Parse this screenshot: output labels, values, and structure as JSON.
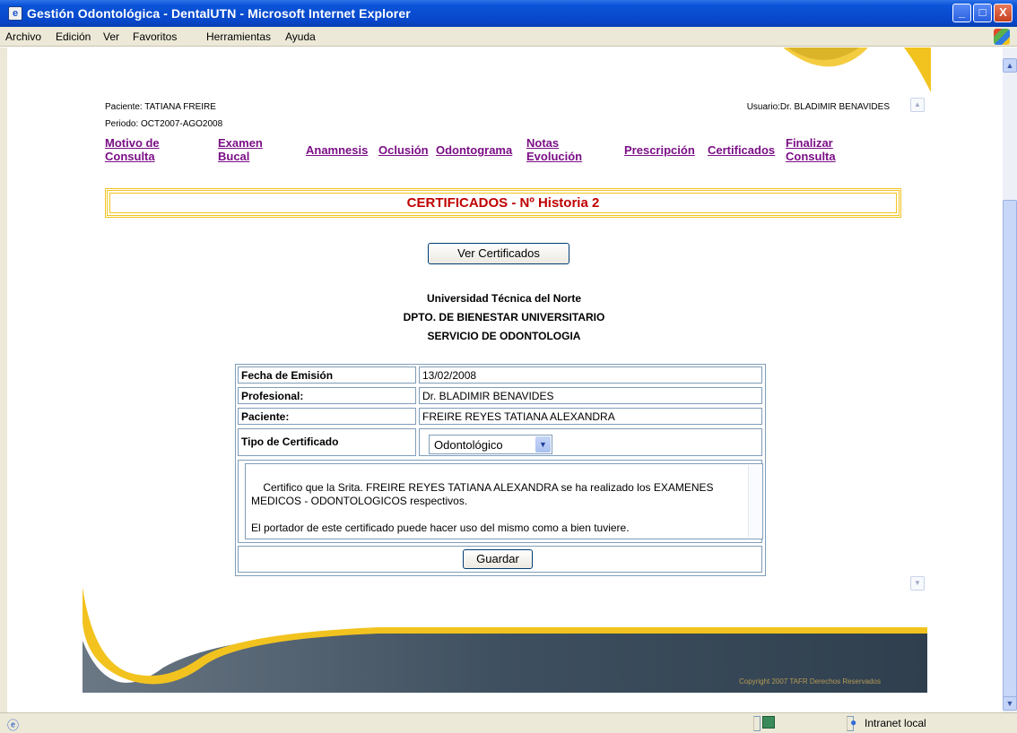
{
  "window": {
    "title": "Gestión Odontológica - DentalUTN - Microsoft Internet Explorer",
    "minimize": "_",
    "maximize": "□",
    "close": "X"
  },
  "menu": [
    "Archivo",
    "Edición",
    "Ver",
    "Favoritos",
    "Herramientas",
    "Ayuda"
  ],
  "header": {
    "patient": "Paciente: TATIANA FREIRE",
    "period": "Periodo: OCT2007-AGO2008",
    "user": "Usuario:Dr. BLADIMIR BENAVIDES"
  },
  "nav": {
    "motivo_1": "Motivo de",
    "motivo_2": "Consulta",
    "examen_1": "Examen",
    "examen_2": "Bucal",
    "anamnesis": "Anamnesis",
    "oclusion": "Oclusión",
    "odontograma": "Odontograma",
    "notas_1": "Notas",
    "notas_2": "Evolución",
    "prescripcion": "Prescripción",
    "certificados": "Certificados",
    "finalizar_1": "Finalizar",
    "finalizar_2": "Consulta"
  },
  "section_title": "CERTIFICADOS - Nº Historia 2",
  "ver_button": "Ver Certificados",
  "institution": {
    "line1": "Universidad Técnica del Norte",
    "line2": "DPTO. DE BIENESTAR UNIVERSITARIO",
    "line3": "SERVICIO DE ODONTOLOGIA"
  },
  "form": {
    "fecha_label": "Fecha de Emisión",
    "fecha_value": "13/02/2008",
    "profesional_label": "Profesional:",
    "profesional_value": "Dr. BLADIMIR BENAVIDES",
    "paciente_label": "Paciente:",
    "paciente_value": "FREIRE REYES TATIANA ALEXANDRA",
    "tipo_label": "Tipo de Certificado",
    "tipo_value": "Odontológico",
    "certificate_text": "Certifico que la Srita. FREIRE REYES TATIANA ALEXANDRA se ha realizado los EXAMENES MEDICOS - ODONTOLOGICOS respectivos.\n\nEl portador de este certificado puede hacer uso del mismo como a bien tuviere.",
    "save_button": "Guardar"
  },
  "footer": {
    "copyright": "Copyright 2007 TAFR Derechos Reservados"
  },
  "status": {
    "zone": "Intranet local"
  },
  "colors": {
    "title_bar": "#0a54d8",
    "link": "#7b0f86",
    "section_title": "#c00000",
    "gold": "#f2c31f",
    "footer_dark": "#3e4f5f"
  }
}
